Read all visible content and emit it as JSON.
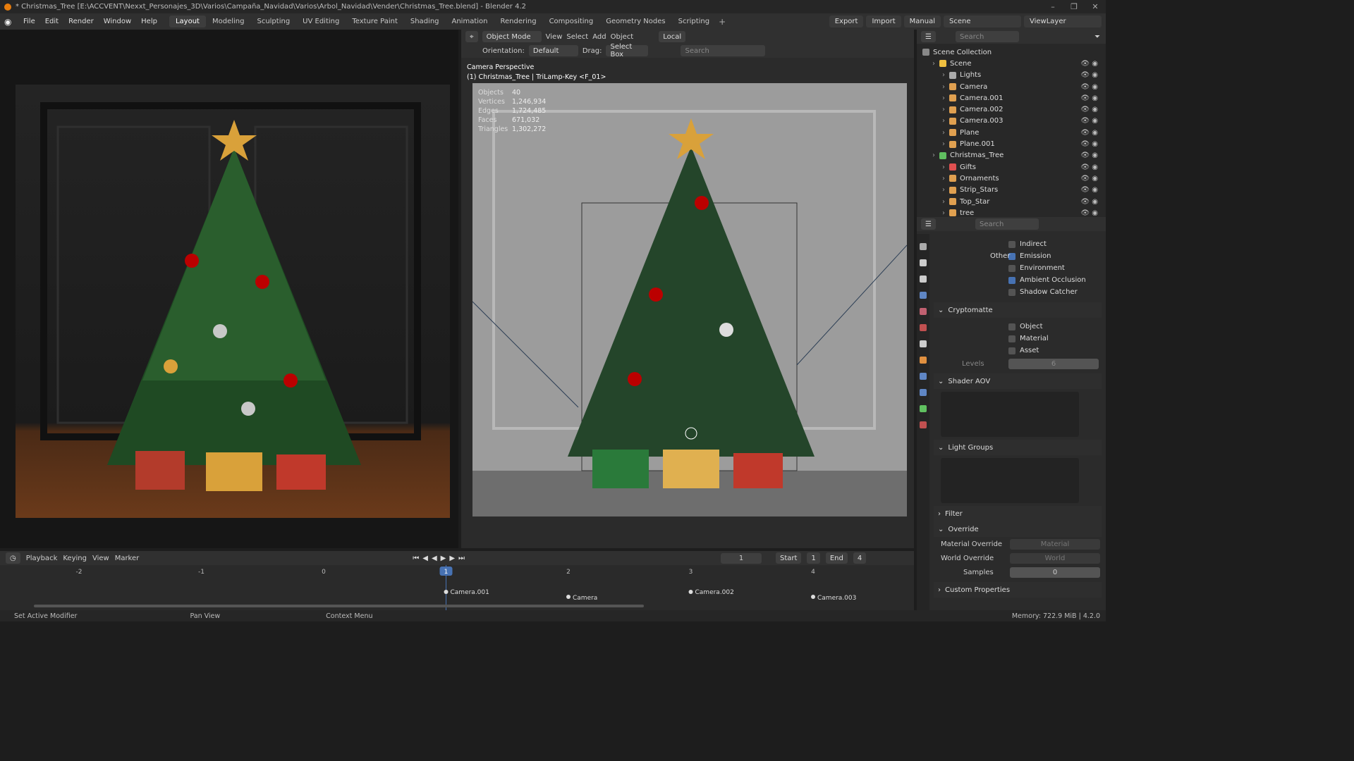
{
  "title": "* Christmas_Tree [E:\\ACCVENT\\Nexxt_Personajes_3D\\Varios\\Campaña_Navidad\\Varios\\Arbol_Navidad\\Vender\\Christmas_Tree.blend] - Blender 4.2",
  "menus": [
    "File",
    "Edit",
    "Render",
    "Window",
    "Help"
  ],
  "workspaces": [
    "Layout",
    "Modeling",
    "Sculpting",
    "UV Editing",
    "Texture Paint",
    "Shading",
    "Animation",
    "Rendering",
    "Compositing",
    "Geometry Nodes",
    "Scripting"
  ],
  "topbar": {
    "export": "Export",
    "import": "Import",
    "manual": "Manual",
    "scene": "Scene",
    "viewlayer": "ViewLayer"
  },
  "viewport_header": {
    "mode": "Object Mode",
    "view": "View",
    "select": "Select",
    "add": "Add",
    "object": "Object",
    "pivot": "Local",
    "orientation_label": "Orientation:",
    "orientation": "Default",
    "drag_label": "Drag:",
    "drag": "Select Box",
    "search": "Search"
  },
  "viewport": {
    "title": "Camera Perspective",
    "subtitle": "(1) Christmas_Tree | TriLamp-Key <F_01>",
    "stats": [
      [
        "Objects",
        "40"
      ],
      [
        "Vertices",
        "1,246,934"
      ],
      [
        "Edges",
        "1,724,485"
      ],
      [
        "Faces",
        "671,032"
      ],
      [
        "Triangles",
        "1,302,272"
      ]
    ]
  },
  "outliner": {
    "search": "Search",
    "collection": "Scene Collection",
    "items": [
      {
        "label": "Scene",
        "indent": 1,
        "color": "#f0c040"
      },
      {
        "label": "Lights",
        "indent": 2,
        "color": "#aaaaaa"
      },
      {
        "label": "Camera",
        "indent": 2,
        "color": "#e0a050"
      },
      {
        "label": "Camera.001",
        "indent": 2,
        "color": "#e0a050"
      },
      {
        "label": "Camera.002",
        "indent": 2,
        "color": "#e0a050"
      },
      {
        "label": "Camera.003",
        "indent": 2,
        "color": "#e0a050"
      },
      {
        "label": "Plane",
        "indent": 2,
        "color": "#e0a050"
      },
      {
        "label": "Plane.001",
        "indent": 2,
        "color": "#e0a050"
      },
      {
        "label": "Christmas_Tree",
        "indent": 1,
        "color": "#60c060"
      },
      {
        "label": "Gifts",
        "indent": 2,
        "color": "#e05050"
      },
      {
        "label": "Ornaments",
        "indent": 2,
        "color": "#e0a050"
      },
      {
        "label": "Strip_Stars",
        "indent": 2,
        "color": "#e0a050"
      },
      {
        "label": "Top_Star",
        "indent": 2,
        "color": "#e0a050"
      },
      {
        "label": "tree",
        "indent": 2,
        "color": "#e0a050"
      }
    ]
  },
  "properties": {
    "search": "Search",
    "passes": [
      {
        "label": "Indirect",
        "checked": false
      },
      {
        "label": "Emission",
        "checked": true,
        "prefix": "Other"
      },
      {
        "label": "Environment",
        "checked": false
      },
      {
        "label": "Ambient Occlusion",
        "checked": true
      },
      {
        "label": "Shadow Catcher",
        "checked": false
      }
    ],
    "cryptomatte": "Cryptomatte",
    "crypto_items": [
      "Object",
      "Material",
      "Asset"
    ],
    "levels_label": "Levels",
    "levels": "6",
    "shader_aov": "Shader AOV",
    "light_groups": "Light Groups",
    "filter": "Filter",
    "override": "Override",
    "material_override_label": "Material Override",
    "material_override": "Material",
    "world_override_label": "World Override",
    "world_override": "World",
    "samples_label": "Samples",
    "samples": "0",
    "custom_props": "Custom Properties"
  },
  "timeline": {
    "playback": "Playback",
    "keying": "Keying",
    "view": "View",
    "marker": "Marker",
    "current": "1",
    "start_label": "Start",
    "start": "1",
    "end_label": "End",
    "end": "4",
    "ticks": [
      "-2",
      "-1",
      "0",
      "1",
      "2",
      "3",
      "4"
    ],
    "markers": [
      {
        "label": "Camera.001",
        "frame": 1
      },
      {
        "label": "Camera",
        "frame": 2
      },
      {
        "label": "Camera.002",
        "frame": 3
      },
      {
        "label": "Camera.003",
        "frame": 4
      }
    ]
  },
  "status": {
    "left": "Set Active Modifier",
    "mid": "Pan View",
    "ctx": "Context Menu",
    "right": "Memory: 722.9 MiB | 4.2.0"
  }
}
